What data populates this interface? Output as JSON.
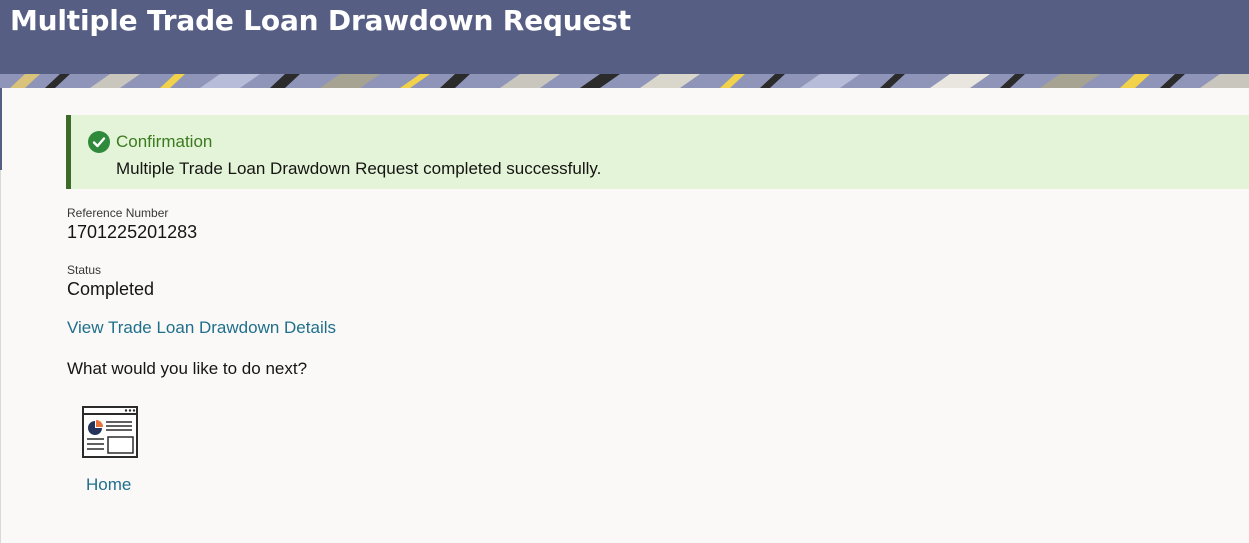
{
  "header": {
    "title": "Multiple Trade Loan Drawdown Request"
  },
  "confirmation": {
    "icon": "check-circle-icon",
    "title": "Confirmation",
    "message": "Multiple Trade Loan Drawdown Request completed successfully.",
    "accent_color": "#3d6b2a",
    "background_color": "#e4f4d8"
  },
  "details": {
    "reference_label": "Reference Number",
    "reference_value": "1701225201283",
    "status_label": "Status",
    "status_value": "Completed"
  },
  "links": {
    "view_details": "View Trade Loan Drawdown Details"
  },
  "next_steps": {
    "prompt": "What would you like to do next?",
    "actions": [
      {
        "label": "Home",
        "icon": "dashboard-icon"
      }
    ]
  },
  "colors": {
    "header_bg": "#575e84",
    "link": "#1f6f8b"
  }
}
